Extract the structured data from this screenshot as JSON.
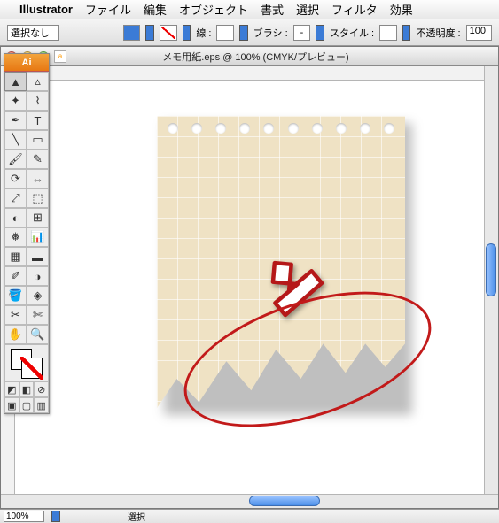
{
  "menubar": {
    "app": "Illustrator",
    "items": [
      "ファイル",
      "編集",
      "オブジェクト",
      "書式",
      "選択",
      "フィルタ",
      "効果"
    ]
  },
  "optbar": {
    "selection": "選択なし",
    "stroke_label": "線 :",
    "brush_label": "ブラシ :",
    "style_label": "スタイル :",
    "opacity_label": "不透明度 :",
    "opacity_value": "100"
  },
  "doc": {
    "title": "メモ用紙.eps @ 100% (CMYK/プレビュー)"
  },
  "toolbox": {
    "logo": "Ai"
  },
  "status": {
    "zoom": "100%",
    "label": "選択"
  }
}
